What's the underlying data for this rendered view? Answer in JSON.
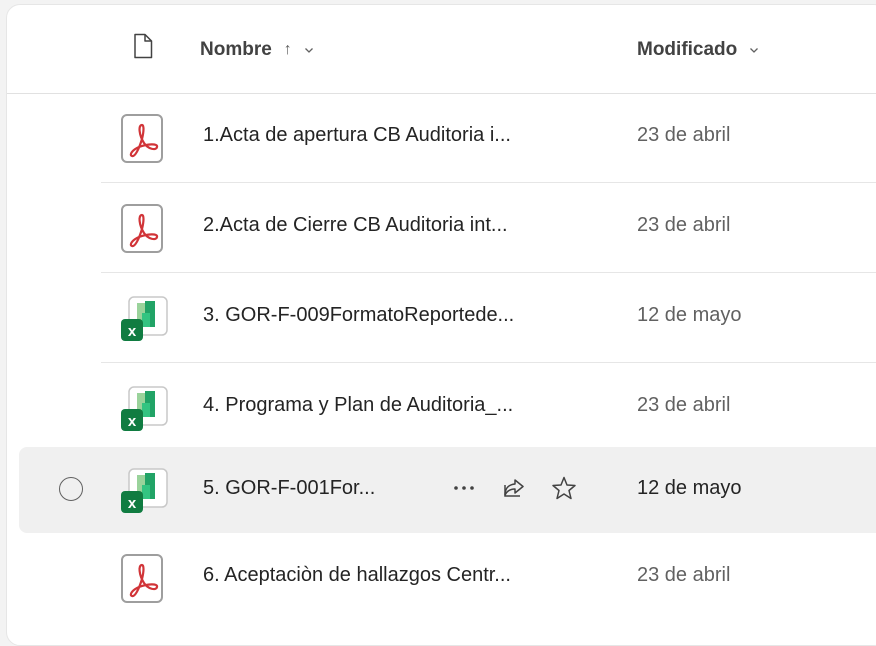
{
  "header": {
    "name_label": "Nombre",
    "sort_arrow": "↑",
    "modified_label": "Modificado"
  },
  "rows": [
    {
      "name": "1.Acta de apertura CB Auditoria i...",
      "modified": "23 de abril",
      "type": "pdf"
    },
    {
      "name": "2.Acta de Cierre CB Auditoria int...",
      "modified": "23 de abril",
      "type": "pdf"
    },
    {
      "name": "3. GOR-F-009FormatoReportede...",
      "modified": "12 de mayo",
      "type": "excel"
    },
    {
      "name": "4. Programa y Plan de Auditoria_...",
      "modified": "23 de abril",
      "type": "excel"
    },
    {
      "name": "5. GOR-F-001For...",
      "modified": "12 de mayo",
      "type": "excel",
      "selected": true
    },
    {
      "name": "6. Aceptaciòn de hallazgos Centr...",
      "modified": "23 de abril",
      "type": "pdf"
    }
  ],
  "icons": {
    "header_file": "document-icon",
    "pdf": "pdf-file-icon",
    "excel": "excel-file-icon",
    "more": "more-icon",
    "share": "share-icon",
    "favorite": "star-icon"
  },
  "colors": {
    "pdf_red": "#d13438",
    "excel_green": "#107c41",
    "selected_row": "#f0f0f0"
  }
}
